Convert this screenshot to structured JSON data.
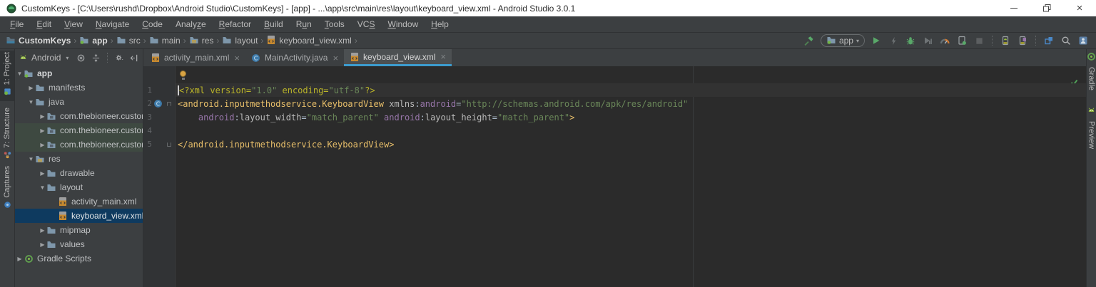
{
  "window": {
    "title": "CustomKeys - [C:\\Users\\rushd\\Dropbox\\Android Studio\\CustomKeys] - [app] - ...\\app\\src\\main\\res\\layout\\keyboard_view.xml - Android Studio 3.0.1",
    "controls": [
      {
        "name": "minimize",
        "glyph": "min"
      },
      {
        "name": "restore",
        "glyph": "restore"
      },
      {
        "name": "close",
        "glyph": "×"
      }
    ]
  },
  "menu": {
    "items": [
      {
        "label": "File",
        "u": 0
      },
      {
        "label": "Edit",
        "u": 0
      },
      {
        "label": "View",
        "u": 0
      },
      {
        "label": "Navigate",
        "u": 0
      },
      {
        "label": "Code",
        "u": 0
      },
      {
        "label": "Analyze",
        "u": 5
      },
      {
        "label": "Refactor",
        "u": 0
      },
      {
        "label": "Build",
        "u": 0
      },
      {
        "label": "Run",
        "u": 1
      },
      {
        "label": "Tools",
        "u": 0
      },
      {
        "label": "VCS",
        "u": 2
      },
      {
        "label": "Window",
        "u": 0
      },
      {
        "label": "Help",
        "u": 0
      }
    ]
  },
  "toolbar": {
    "breadcrumb": [
      {
        "label": "CustomKeys",
        "icon": "project-folder",
        "bold": true
      },
      {
        "label": "app",
        "icon": "module-folder",
        "bold": true
      },
      {
        "label": "src",
        "icon": "folder"
      },
      {
        "label": "main",
        "icon": "folder"
      },
      {
        "label": "res",
        "icon": "res-folder"
      },
      {
        "label": "layout",
        "icon": "folder"
      },
      {
        "label": "keyboard_view.xml",
        "icon": "xml-file"
      }
    ],
    "separator": "›",
    "run_config": {
      "label": "app",
      "icon": "module-folder"
    },
    "right_icons": [
      "build-hammer",
      "run-config-combo",
      "run",
      "apply-changes",
      "debug",
      "profile",
      "profiler-gauge",
      "attach-debugger",
      "stop",
      "sep",
      "avd-manager",
      "sdk-manager",
      "sep",
      "sync-project",
      "search",
      "device-monitor"
    ]
  },
  "left_toolbar": [
    {
      "label": "1: Project",
      "icon": "project-tab",
      "active": true
    },
    {
      "label": "7: Structure",
      "icon": "structure-tab",
      "active": false
    },
    {
      "label": "Captures",
      "icon": "captures-tab",
      "active": false
    }
  ],
  "right_toolbar": [
    {
      "label": "Gradle",
      "icon": "gradle",
      "active": false
    },
    {
      "label": "Preview",
      "icon": "android",
      "active": false
    }
  ],
  "project_panel": {
    "view_selector": "Android",
    "dropdown_arrow": "▾",
    "header_icons": [
      "locate",
      "collapse-all",
      "sep",
      "settings-gear",
      "hide-panel"
    ],
    "tree": [
      {
        "label": "app",
        "icon": "module-folder",
        "indent": 0,
        "arrow": "down",
        "bold": true
      },
      {
        "label": "manifests",
        "icon": "folder",
        "indent": 1,
        "arrow": "right"
      },
      {
        "label": "java",
        "icon": "folder",
        "indent": 1,
        "arrow": "down"
      },
      {
        "label": "com.thebioneer.custom",
        "icon": "package",
        "indent": 2,
        "arrow": "right"
      },
      {
        "label": "com.thebioneer.custom",
        "icon": "package",
        "indent": 2,
        "arrow": "right",
        "test": true
      },
      {
        "label": "com.thebioneer.custom",
        "icon": "package",
        "indent": 2,
        "arrow": "right",
        "test": true
      },
      {
        "label": "res",
        "icon": "res-folder",
        "indent": 1,
        "arrow": "down"
      },
      {
        "label": "drawable",
        "icon": "folder",
        "indent": 2,
        "arrow": "right"
      },
      {
        "label": "layout",
        "icon": "folder",
        "indent": 2,
        "arrow": "down"
      },
      {
        "label": "activity_main.xml",
        "icon": "xml-file",
        "indent": 3,
        "arrow": null
      },
      {
        "label": "keyboard_view.xml",
        "icon": "xml-file",
        "indent": 3,
        "arrow": null,
        "selected": true
      },
      {
        "label": "mipmap",
        "icon": "folder",
        "indent": 2,
        "arrow": "right"
      },
      {
        "label": "values",
        "icon": "folder",
        "indent": 2,
        "arrow": "right"
      },
      {
        "label": "Gradle Scripts",
        "icon": "gradle",
        "indent": 0,
        "arrow": "right"
      }
    ]
  },
  "editor": {
    "tabs": [
      {
        "label": "activity_main.xml",
        "icon": "xml-file",
        "close": "×",
        "active": false
      },
      {
        "label": "MainActivity.java",
        "icon": "java-class",
        "close": "×",
        "active": false
      },
      {
        "label": "keyboard_view.xml",
        "icon": "xml-file",
        "close": "×",
        "active": true
      }
    ],
    "inspection_status": "ok",
    "lines": [
      {
        "num": "1",
        "current": true,
        "caret": true,
        "tokens": [
          [
            "<?xml version=",
            "pi"
          ],
          [
            "\"1.0\"",
            "str"
          ],
          [
            " encoding=",
            "pi"
          ],
          [
            "\"utf-8\"",
            "str"
          ],
          [
            "?>",
            "pi"
          ]
        ]
      },
      {
        "num": "2",
        "gutter_icon": "java-class",
        "fold": "start",
        "tokens": [
          [
            "<android.inputmethodservice.KeyboardView",
            "tag"
          ],
          [
            " ",
            "plain"
          ],
          [
            "xmlns",
            "attr"
          ],
          [
            ":",
            "plain"
          ],
          [
            "android",
            "ns"
          ],
          [
            "=",
            "plain"
          ],
          [
            "\"http://schemas.android.com/apk/res/android\"",
            "str"
          ]
        ]
      },
      {
        "num": "3",
        "tokens": [
          [
            "    ",
            "plain"
          ],
          [
            "android",
            "ns"
          ],
          [
            ":",
            "plain"
          ],
          [
            "layout_width",
            "attr"
          ],
          [
            "=",
            "plain"
          ],
          [
            "\"match_parent\"",
            "str"
          ],
          [
            " ",
            "plain"
          ],
          [
            "android",
            "ns"
          ],
          [
            ":",
            "plain"
          ],
          [
            "layout_height",
            "attr"
          ],
          [
            "=",
            "plain"
          ],
          [
            "\"match_parent\"",
            "str"
          ],
          [
            ">",
            "tag"
          ]
        ]
      },
      {
        "num": "4",
        "tokens": []
      },
      {
        "num": "5",
        "fold": "end",
        "tokens": [
          [
            "</android.inputmethodservice.KeyboardView>",
            "tag"
          ]
        ]
      }
    ]
  },
  "colors": {
    "accent_tab_underline": "#3C9CCE",
    "selection_blue": "#0E3A5F",
    "editor_bg": "#2B2B2B",
    "panel_bg": "#3C3F41",
    "run_green": "#59A869",
    "check_green": "#4F9E57"
  }
}
